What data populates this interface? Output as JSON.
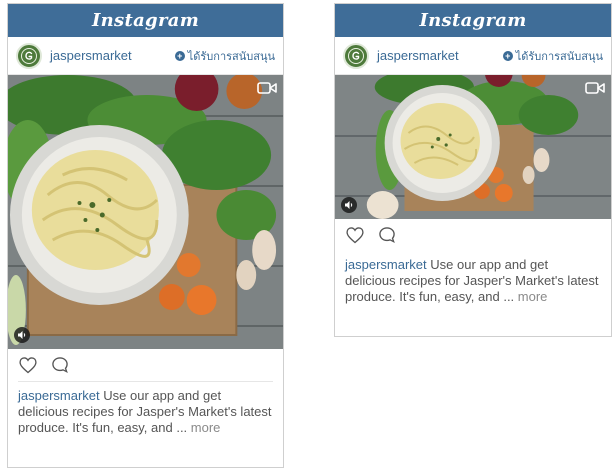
{
  "ads": [
    {
      "brand_logo": "Instagram",
      "username": "jaspersmarket",
      "sponsored_label": "ได้รับการสนับสนุน",
      "caption_user": "jaspersmarket",
      "caption_text": " Use our app and get delicious recipes for Jasper's Market's latest produce. It's fun, easy, and ... ",
      "more_label": "more"
    },
    {
      "brand_logo": "Instagram",
      "username": "jaspersmarket",
      "sponsored_label": "ได้รับการสนับสนุน",
      "caption_user": "jaspersmarket",
      "caption_text": " Use our app and get delicious recipes for Jasper's Market's latest produce. It's fun, easy, and ... ",
      "more_label": "more"
    }
  ],
  "icons": {
    "video": "video-camera-icon",
    "sound": "speaker-icon",
    "like": "heart-icon",
    "comment": "comment-icon",
    "sponsored": "plus-circle-icon"
  },
  "colors": {
    "header": "#3f6d98",
    "link": "#3a6a95",
    "avatar": "#4e7a3b"
  }
}
